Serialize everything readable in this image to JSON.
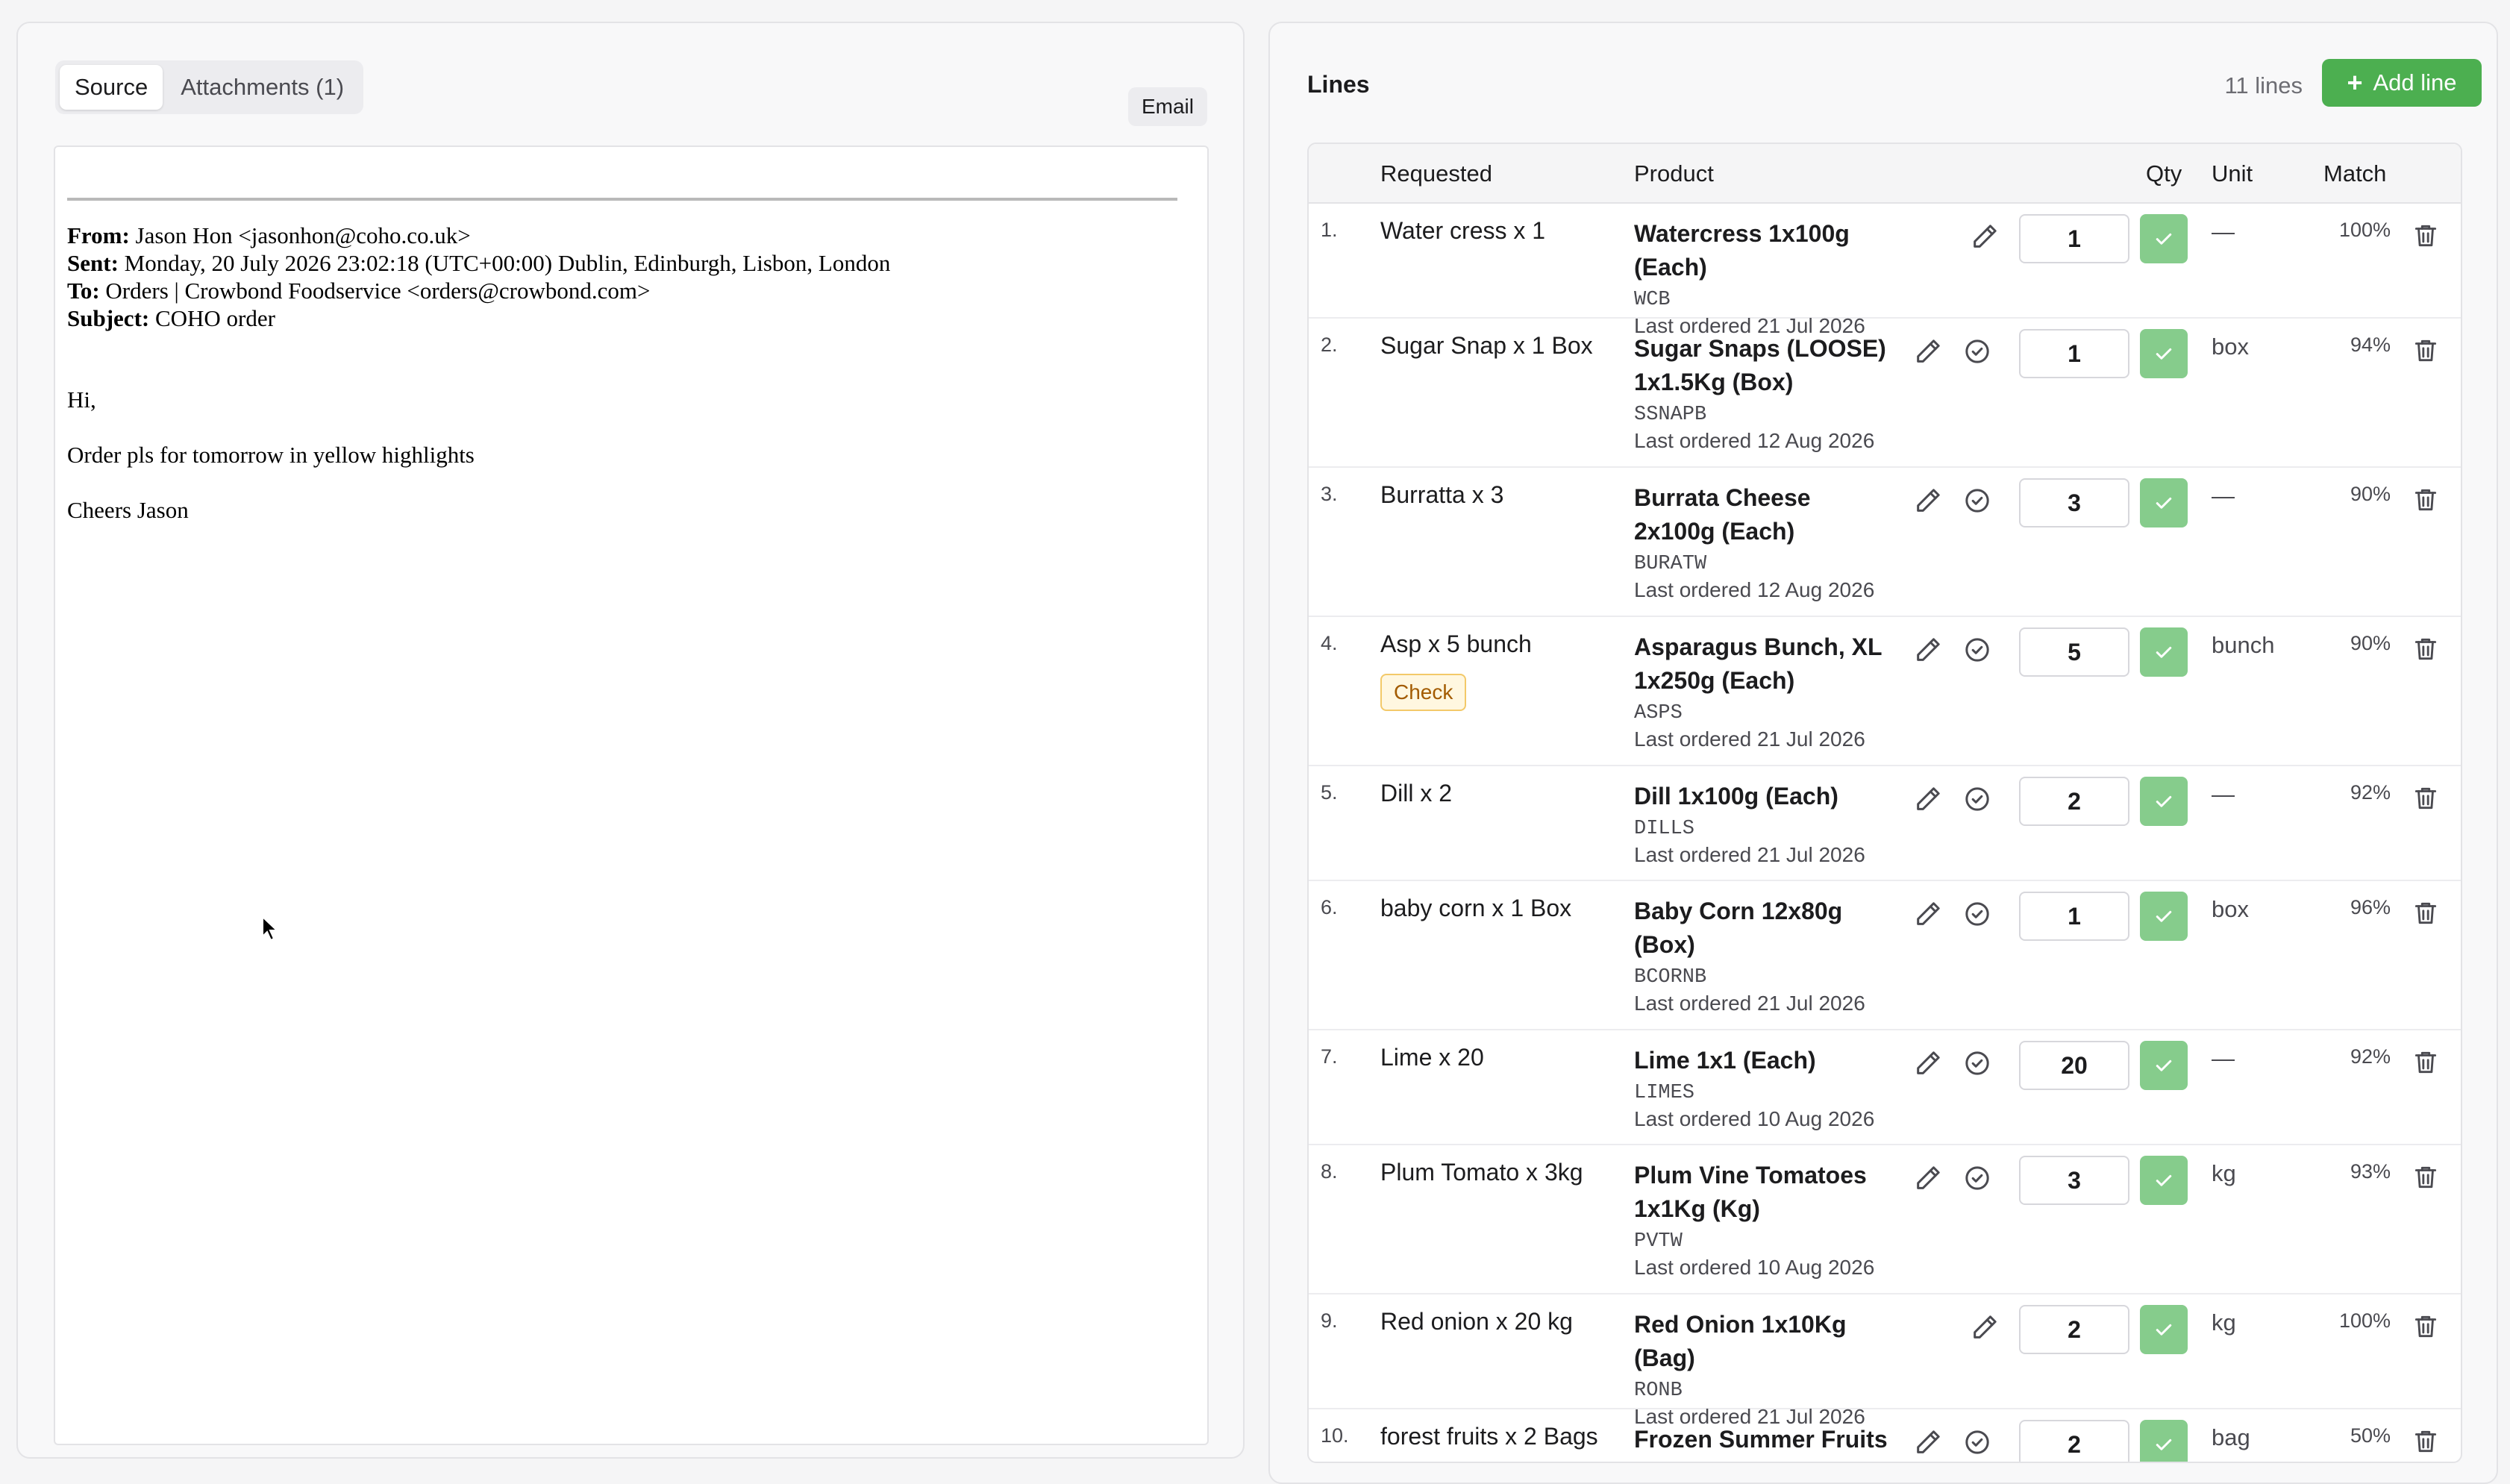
{
  "source_panel": {
    "tabs": [
      {
        "label": "Source",
        "active": true
      },
      {
        "label": "Attachments (1)",
        "active": false
      }
    ],
    "format_badge": "Email",
    "email": {
      "from_label": "From:",
      "from": "Jason Hon <jasonhon@coho.co.uk>",
      "sent_label": "Sent:",
      "sent": "Monday, 20 July 2026 23:02:18 (UTC+00:00) Dublin, Edinburgh, Lisbon, London",
      "to_label": "To:",
      "to": "Orders | Crowbond Foodservice <orders@crowbond.com>",
      "subject_label": "Subject:",
      "subject": "COHO order",
      "body": [
        "Hi,",
        "Order pls for tomorrow in yellow highlights",
        "Cheers Jason"
      ]
    }
  },
  "lines_panel": {
    "title": "Lines",
    "count": "11 lines",
    "add_button": "Add line",
    "columns": {
      "requested": "Requested",
      "product": "Product",
      "qty": "Qty",
      "unit": "Unit",
      "match": "Match"
    },
    "rows": [
      {
        "num": "1.",
        "requested": "Water cress x 1",
        "check": "",
        "product": "Watercress 1x100g (Each)",
        "code": "WCB",
        "last": "Last ordered 21 Jul 2026",
        "qty": "1",
        "unit": "—",
        "match": "100%",
        "confirm_icon": false
      },
      {
        "num": "2.",
        "requested": "Sugar Snap x 1 Box",
        "check": "",
        "product": "Sugar Snaps (LOOSE) 1x1.5Kg (Box)",
        "code": "SSNAPB",
        "last": "Last ordered 12 Aug 2026",
        "qty": "1",
        "unit": "box",
        "match": "94%",
        "confirm_icon": true
      },
      {
        "num": "3.",
        "requested": "Burratta x 3",
        "check": "",
        "product": "Burrata Cheese 2x100g (Each)",
        "code": "BURATW",
        "last": "Last ordered 12 Aug 2026",
        "qty": "3",
        "unit": "—",
        "match": "90%",
        "confirm_icon": true
      },
      {
        "num": "4.",
        "requested": "Asp x 5 bunch",
        "check": "Check",
        "product": "Asparagus Bunch, XL 1x250g (Each)",
        "code": "ASPS",
        "last": "Last ordered 21 Jul 2026",
        "qty": "5",
        "unit": "bunch",
        "match": "90%",
        "confirm_icon": true
      },
      {
        "num": "5.",
        "requested": "Dill x 2",
        "check": "",
        "product": "Dill 1x100g (Each)",
        "code": "DILLS",
        "last": "Last ordered 21 Jul 2026",
        "qty": "2",
        "unit": "—",
        "match": "92%",
        "confirm_icon": true
      },
      {
        "num": "6.",
        "requested": "baby corn x 1 Box",
        "check": "",
        "product": "Baby Corn 12x80g (Box)",
        "code": "BCORNB",
        "last": "Last ordered 21 Jul 2026",
        "qty": "1",
        "unit": "box",
        "match": "96%",
        "confirm_icon": true
      },
      {
        "num": "7.",
        "requested": "Lime x 20",
        "check": "",
        "product": "Lime 1x1 (Each)",
        "code": "LIMES",
        "last": "Last ordered 10 Aug 2026",
        "qty": "20",
        "unit": "—",
        "match": "92%",
        "confirm_icon": true
      },
      {
        "num": "8.",
        "requested": "Plum Tomato x 3kg",
        "check": "",
        "product": "Plum Vine Tomatoes 1x1Kg (Kg)",
        "code": "PVTW",
        "last": "Last ordered 10 Aug 2026",
        "qty": "3",
        "unit": "kg",
        "match": "93%",
        "confirm_icon": true
      },
      {
        "num": "9.",
        "requested": "Red onion x 20 kg",
        "check": "",
        "product": "Red Onion 1x10Kg (Bag)",
        "code": "RONB",
        "last": "Last ordered 21 Jul 2026",
        "qty": "2",
        "unit": "kg",
        "match": "100%",
        "confirm_icon": false
      },
      {
        "num": "10.",
        "requested": "forest fruits x 2 Bags",
        "check": "",
        "product": "Frozen Summer Fruits",
        "code": "",
        "last": "",
        "qty": "2",
        "unit": "bag",
        "match": "50%",
        "confirm_icon": true
      }
    ]
  },
  "colors": {
    "accent_green": "#4caf50",
    "confirm_green": "#86cc8c",
    "check_badge_text": "#a35b00"
  },
  "icons": [
    "pencil-icon",
    "circle-check-icon",
    "check-icon",
    "trash-icon",
    "plus-icon",
    "cursor-icon"
  ]
}
